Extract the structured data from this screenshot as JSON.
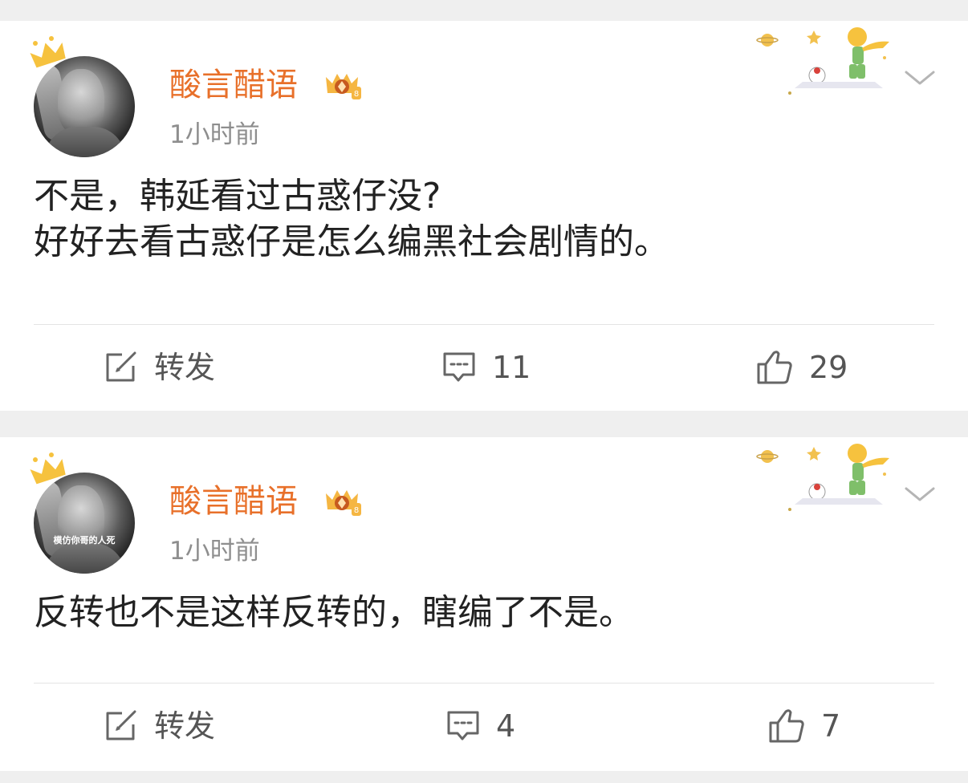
{
  "comments": [
    {
      "username": "酸言醋语",
      "time": "1小时前",
      "avatar_caption": "",
      "content_lines": [
        "不是，韩延看过古惑仔没?",
        "好好去看古惑仔是怎么编黑社会剧情的。"
      ],
      "actions": {
        "repost_label": "转发",
        "comment_count": "11",
        "like_count": "29"
      }
    },
    {
      "username": "酸言醋语",
      "time": "1小时前",
      "avatar_caption": "模仿你哥的人死",
      "content_lines": [
        "反转也不是这样反转的，瞎编了不是。"
      ],
      "actions": {
        "repost_label": "转发",
        "comment_count": "4",
        "like_count": "7"
      }
    }
  ],
  "colors": {
    "username": "#e8702a",
    "time": "#8e8e8e",
    "text": "#222222",
    "action": "#555555",
    "background": "#efefef",
    "card": "#ffffff",
    "crown": "#f6c23e"
  },
  "icons": [
    "crown-icon",
    "vip-crown-badge-icon",
    "little-prince-decoration",
    "chevron-down-icon",
    "repost-icon",
    "comment-icon",
    "like-icon"
  ]
}
